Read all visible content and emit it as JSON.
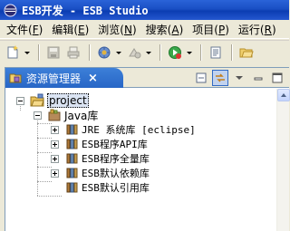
{
  "window": {
    "title": "ESB开发 - ESB Studio"
  },
  "menu": {
    "items": [
      {
        "label": "文件",
        "accel": "F"
      },
      {
        "label": "编辑",
        "accel": "E"
      },
      {
        "label": "浏览",
        "accel": "N"
      },
      {
        "label": "搜索",
        "accel": "A"
      },
      {
        "label": "项目",
        "accel": "P"
      },
      {
        "label": "运行",
        "accel": "R"
      }
    ]
  },
  "toolbar": {
    "buttons": [
      {
        "icon": "new-wizard-icon",
        "has_dropdown": true
      },
      {
        "icon": "save-icon",
        "has_dropdown": false
      },
      {
        "icon": "print-icon",
        "has_dropdown": false
      },
      {
        "icon": "debug-icon",
        "has_dropdown": true
      },
      {
        "icon": "run-icon",
        "has_dropdown": true
      },
      {
        "icon": "new-java-project-icon",
        "has_dropdown": true
      },
      {
        "icon": "open-type-icon",
        "has_dropdown": false
      },
      {
        "icon": "open-folder-icon",
        "has_dropdown": false
      }
    ]
  },
  "view": {
    "tab_label": "资源管理器",
    "close_symbol": "×"
  },
  "tree": {
    "root": {
      "label": "project",
      "expanded": true,
      "selected": true
    },
    "container": {
      "label": "Java库",
      "expanded": true
    },
    "libraries": [
      {
        "label": "JRE 系统库 [eclipse]"
      },
      {
        "label": "ESB程序API库"
      },
      {
        "label": "ESB程序全量库"
      },
      {
        "label": "ESB默认依赖库"
      },
      {
        "label": "ESB默认引用库"
      }
    ]
  },
  "colors": {
    "title_bar": "#0b3db2",
    "view_tab": "#2866c6",
    "background": "#ece9d8"
  }
}
